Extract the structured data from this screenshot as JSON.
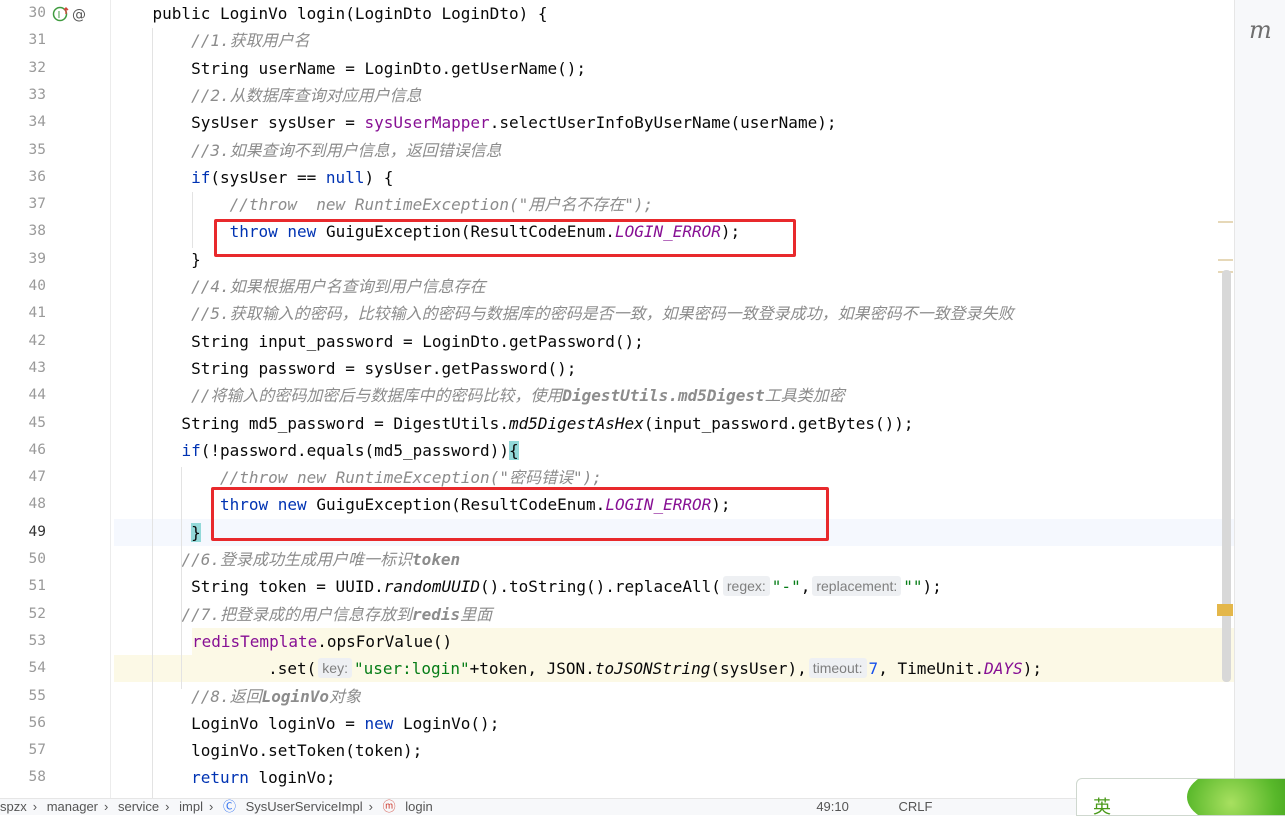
{
  "editor": {
    "lines": [
      {
        "num": "30",
        "segs": [
          [
            "",
            "    public LoginVo login(LoginDto LoginDto) {"
          ]
        ]
      },
      {
        "num": "31",
        "segs": [
          [
            "",
            "        "
          ],
          [
            "cm",
            "//1.获取用户名"
          ]
        ]
      },
      {
        "num": "32",
        "segs": [
          [
            "",
            "        String userName = LoginDto.getUserName();"
          ]
        ]
      },
      {
        "num": "33",
        "segs": [
          [
            "",
            "        "
          ],
          [
            "cm",
            "//2.从数据库查询对应用户信息"
          ]
        ]
      },
      {
        "num": "34",
        "segs": [
          [
            "",
            "        SysUser sysUser = "
          ],
          [
            "fld",
            "sysUserMapper"
          ],
          [
            "",
            ".selectUserInfoByUserName(userName);"
          ]
        ]
      },
      {
        "num": "35",
        "segs": [
          [
            "",
            "        "
          ],
          [
            "cm",
            "//3.如果查询不到用户信息，返回错误信息"
          ]
        ]
      },
      {
        "num": "36",
        "segs": [
          [
            "",
            "        "
          ],
          [
            "kw",
            "if"
          ],
          [
            "",
            "(sysUser == "
          ],
          [
            "kw",
            "null"
          ],
          [
            "",
            ") {"
          ]
        ]
      },
      {
        "num": "37",
        "segs": [
          [
            "",
            "            "
          ],
          [
            "cm",
            "//throw  new RuntimeException(\"用户名不存在\");"
          ]
        ]
      },
      {
        "num": "38",
        "segs": [
          [
            "",
            "            "
          ],
          [
            "kw",
            "throw"
          ],
          [
            "",
            " "
          ],
          [
            "kw",
            "new"
          ],
          [
            "",
            " GuiguException(ResultCodeEnum."
          ],
          [
            "cst",
            "LOGIN_ERROR"
          ],
          [
            "",
            ");"
          ]
        ]
      },
      {
        "num": "39",
        "segs": [
          [
            "",
            "        }"
          ]
        ]
      },
      {
        "num": "40",
        "segs": [
          [
            "",
            "        "
          ],
          [
            "cm",
            "//4.如果根据用户名查询到用户信息存在"
          ]
        ]
      },
      {
        "num": "41",
        "segs": [
          [
            "",
            "        "
          ],
          [
            "cm",
            "//5.获取输入的密码，比较输入的密码与数据库的密码是否一致，如果密码一致登录成功，如果密码不一致登录失败"
          ]
        ]
      },
      {
        "num": "42",
        "segs": [
          [
            "",
            "        String input_password = LoginDto.getPassword();"
          ]
        ]
      },
      {
        "num": "43",
        "segs": [
          [
            "",
            "        String password = sysUser.getPassword();"
          ]
        ]
      },
      {
        "num": "44",
        "segs": [
          [
            "",
            "        "
          ],
          [
            "cm",
            "//将输入的密码加密后与数据库中的密码比较，使用"
          ],
          [
            "cm-b",
            "DigestUtils.md5Digest"
          ],
          [
            "cm",
            "工具类加密"
          ]
        ]
      },
      {
        "num": "45",
        "segs": [
          [
            "",
            "       String md5_password = DigestUtils."
          ],
          [
            "stat",
            "md5DigestAsHex"
          ],
          [
            "",
            "(input_password.getBytes());"
          ]
        ]
      },
      {
        "num": "46",
        "segs": [
          [
            "",
            "       "
          ],
          [
            "kw",
            "if"
          ],
          [
            "",
            "(!password.equals(md5_password))"
          ],
          [
            "brace-hl",
            "{"
          ]
        ]
      },
      {
        "num": "47",
        "segs": [
          [
            "",
            "           "
          ],
          [
            "cm",
            "//throw new RuntimeException(\"密码错误\");"
          ]
        ]
      },
      {
        "num": "48",
        "segs": [
          [
            "",
            "           "
          ],
          [
            "kw",
            "throw"
          ],
          [
            "",
            " "
          ],
          [
            "kw",
            "new"
          ],
          [
            "",
            " GuiguException(ResultCodeEnum."
          ],
          [
            "cst",
            "LOGIN_ERROR"
          ],
          [
            "",
            ");"
          ]
        ]
      },
      {
        "num": "49",
        "segs": [
          [
            "",
            "        "
          ],
          [
            "brace-hl",
            "}"
          ]
        ]
      },
      {
        "num": "50",
        "segs": [
          [
            "",
            "       "
          ],
          [
            "cm",
            "//6.登录成功生成用户唯一标识"
          ],
          [
            "cm-b",
            "token"
          ]
        ]
      },
      {
        "num": "51",
        "segs": [
          [
            "",
            "        String token = UUID."
          ],
          [
            "stat",
            "randomUUID"
          ],
          [
            "",
            "().toString().replaceAll("
          ],
          [
            "hint",
            "regex:"
          ],
          [
            "str",
            "\"-\""
          ],
          [
            "",
            ","
          ],
          [
            "hint",
            "replacement:"
          ],
          [
            "str",
            "\"\""
          ],
          [
            "",
            ");"
          ]
        ]
      },
      {
        "num": "52",
        "segs": [
          [
            "",
            "       "
          ],
          [
            "cm",
            "//7.把登录成的用户信息存放到"
          ],
          [
            "cm-b",
            "redis"
          ],
          [
            "cm",
            "里面"
          ]
        ]
      },
      {
        "num": "53",
        "segs": [
          [
            "",
            "        "
          ],
          [
            "fld",
            "redisTemplate"
          ],
          [
            "",
            ".opsForValue()"
          ]
        ]
      },
      {
        "num": "54",
        "segs": [
          [
            "",
            "                .set("
          ],
          [
            "hint",
            "key:"
          ],
          [
            "str",
            "\"user:login\""
          ],
          [
            "",
            "+token, JSON."
          ],
          [
            "stat",
            "toJSONString"
          ],
          [
            "",
            "(sysUser),"
          ],
          [
            "hint",
            "timeout:"
          ],
          [
            "num",
            "7"
          ],
          [
            "",
            ", TimeUnit."
          ],
          [
            "cst",
            "DAYS"
          ],
          [
            "",
            ");"
          ]
        ]
      },
      {
        "num": "55",
        "segs": [
          [
            "",
            "        "
          ],
          [
            "cm",
            "//8.返回"
          ],
          [
            "cm-b",
            "LoginVo"
          ],
          [
            "cm",
            "对象"
          ]
        ]
      },
      {
        "num": "56",
        "segs": [
          [
            "",
            "        LoginVo loginVo = "
          ],
          [
            "kw",
            "new"
          ],
          [
            "",
            " LoginVo();"
          ]
        ]
      },
      {
        "num": "57",
        "segs": [
          [
            "",
            "        loginVo.setToken(token);"
          ]
        ]
      },
      {
        "num": "58",
        "segs": [
          [
            "",
            "        "
          ],
          [
            "kw",
            "return"
          ],
          [
            "",
            " loginVo;"
          ]
        ]
      }
    ]
  },
  "gutter_icons": [
    "implementation-up-icon",
    "override-at-icon"
  ],
  "right_panel": {
    "label": "m"
  },
  "breadcrumb": [
    "spzx",
    "manager",
    "service",
    "impl",
    "SysUserServiceImpl",
    "login",
    "49:10",
    "CRLF"
  ],
  "ime": {
    "label": "英"
  },
  "colors": {
    "keyword": "#0033b3",
    "field": "#871094",
    "comment": "#8c8c8c",
    "string": "#067d17",
    "number": "#1750eb",
    "annotation_box": "#e8292c"
  }
}
